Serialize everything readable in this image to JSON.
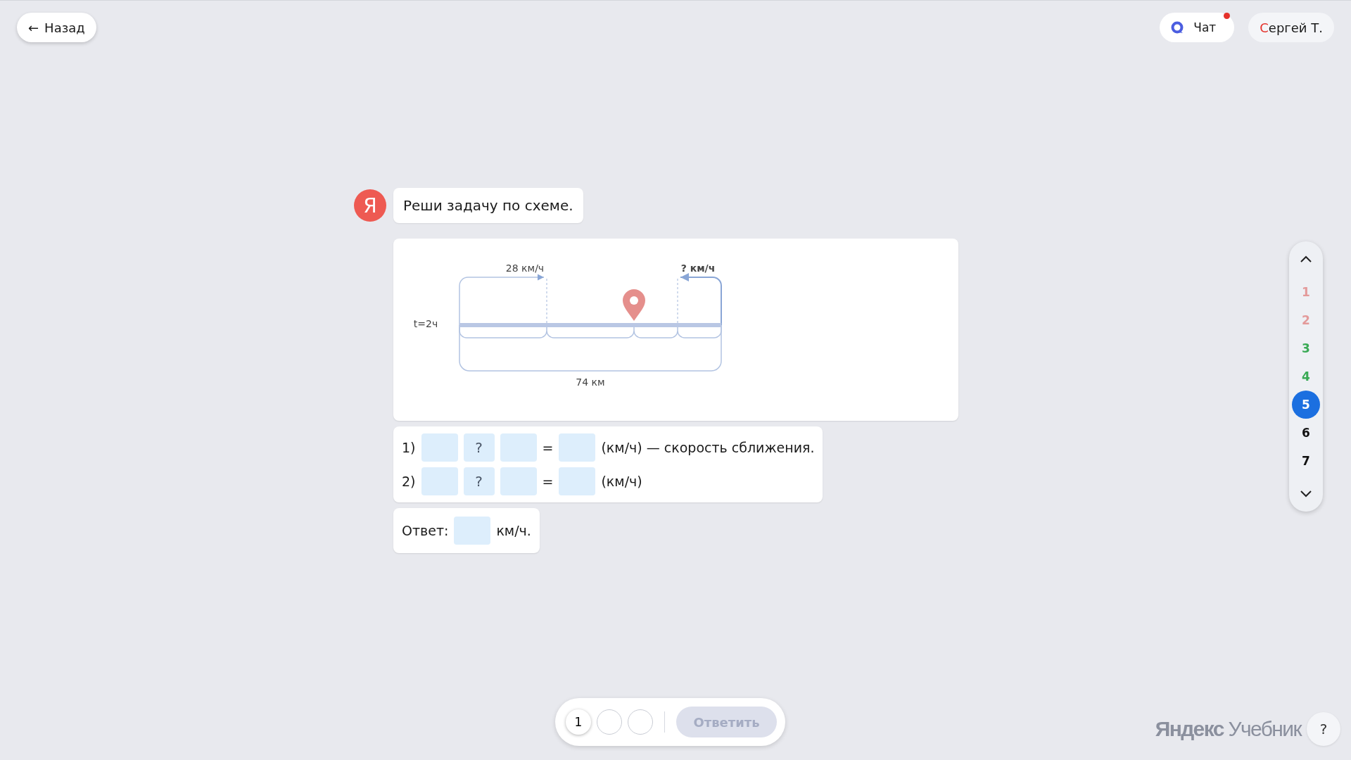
{
  "header": {
    "back": {
      "arrow": "←",
      "label": "Назад"
    },
    "chat": {
      "label": "Чат",
      "unread": true
    },
    "user": {
      "name": "Сергей Т."
    }
  },
  "message": {
    "avatar_letter": "Я",
    "text": "Реши задачу по схеме."
  },
  "diagram": {
    "speed_left": "28 км/ч",
    "speed_right": "? км/ч",
    "time": "t=2ч",
    "distance": "74 км"
  },
  "equations": [
    {
      "number": "1)",
      "operator": "?",
      "equals": "=",
      "unit": "(км/ч) — скорость сближения."
    },
    {
      "number": "2)",
      "operator": "?",
      "equals": "=",
      "unit": "(км/ч)"
    }
  ],
  "answer": {
    "label": "Ответ:",
    "unit": "км/ч."
  },
  "task_nav": [
    {
      "label": "1",
      "color": "#e39a9a",
      "selected": false
    },
    {
      "label": "2",
      "color": "#e39a9a",
      "selected": false
    },
    {
      "label": "3",
      "color": "#3aaa55",
      "selected": false
    },
    {
      "label": "4",
      "color": "#3aaa55",
      "selected": false
    },
    {
      "label": "5",
      "color": "#1b6fe0",
      "selected": true
    },
    {
      "label": "6",
      "color": "#111111",
      "selected": false
    },
    {
      "label": "7",
      "color": "#111111",
      "selected": false
    }
  ],
  "footer": {
    "attempts": [
      {
        "label": "1",
        "current": true
      },
      {
        "current": false
      },
      {
        "current": false
      }
    ],
    "submit": {
      "label": "Ответить",
      "disabled": true
    },
    "brand": "**Яндекс** Учебник",
    "help": "?"
  }
}
